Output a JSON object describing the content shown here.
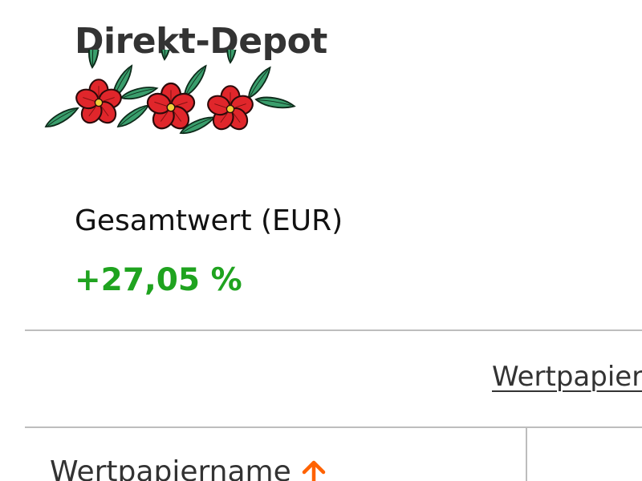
{
  "header": {
    "title": "Direkt-Depot"
  },
  "summary": {
    "total_label": "Gesamtwert (EUR)",
    "total_change": "+27,05 %"
  },
  "tabs": {
    "securities_label": "Wertpapiere"
  },
  "table": {
    "columns": [
      {
        "label": "Wertpapiername",
        "sort": "ascending",
        "sort_icon": "arrow-up-icon"
      }
    ]
  },
  "colors": {
    "positive": "#1fa31f",
    "accent": "#ff6200",
    "divider": "#bdbdbd",
    "flower_petal": "#e0262b",
    "leaf": "#3a9e6c"
  }
}
